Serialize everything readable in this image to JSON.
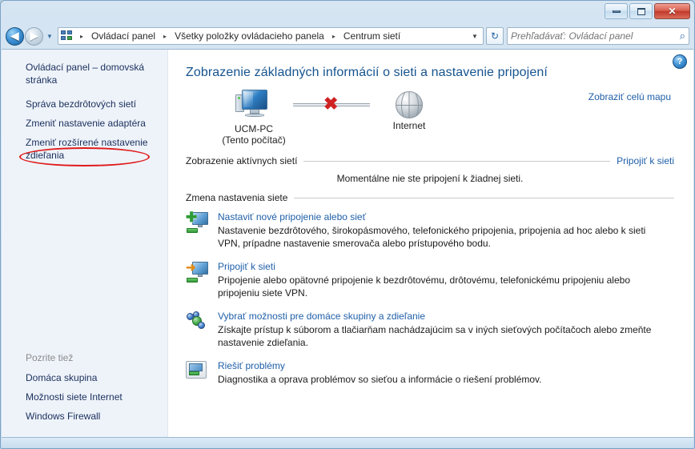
{
  "window": {
    "minimize_label": "—",
    "maximize_label": "❐",
    "close_label": "✕"
  },
  "navigation": {
    "back_label": "◀",
    "forward_label": "▶",
    "history_dropdown_label": "▼",
    "refresh_label": "↻",
    "breadcrumb": [
      "Ovládací panel",
      "Všetky položky ovládacieho panela",
      "Centrum sietí"
    ],
    "breadcrumb_separator": "▸",
    "address_dropdown_label": "▼"
  },
  "search": {
    "placeholder": "Prehľadávať: Ovládací panel",
    "value": "",
    "icon_label": "⌕"
  },
  "sidebar": {
    "home_link": "Ovládací panel – domovská stránka",
    "items": [
      "Správa bezdrôtových sietí",
      "Zmeniť nastavenie adaptéra",
      "Zmeniť rozšírené nastavenie zdieľania"
    ],
    "see_also_heading": "Pozrite tiež",
    "see_also": [
      "Domáca skupina",
      "Možnosti siete Internet",
      "Windows Firewall"
    ],
    "highlight_color": "#e01b1b"
  },
  "content": {
    "help_label": "?",
    "title": "Zobrazenie základných informácií o sieti a nastavenie pripojení",
    "map": {
      "view_full_map": "Zobraziť celú mapu",
      "computer_name": "UCM-PC",
      "computer_sub": "(Tento počítač)",
      "internet_label": "Internet",
      "connection_broken_mark": "✖"
    },
    "active_networks": {
      "title": "Zobrazenie aktívnych sietí",
      "action": "Pripojiť k sieti",
      "status": "Momentálne nie ste pripojení k žiadnej sieti."
    },
    "change_settings": {
      "title": "Zmena nastavenia siete"
    },
    "tasks": [
      {
        "icon": "setup-new-connection-icon",
        "link": "Nastaviť nové pripojenie alebo sieť",
        "description": "Nastavenie bezdrôtového, širokopásmového, telefonického pripojenia, pripojenia ad hoc alebo k sieti VPN, prípadne nastavenie smerovača alebo prístupového bodu."
      },
      {
        "icon": "connect-to-network-icon",
        "link": "Pripojiť k sieti",
        "description": "Pripojenie alebo opätovné pripojenie k bezdrôtovému, drôtovému, telefonickému pripojeniu alebo pripojeniu siete VPN."
      },
      {
        "icon": "homegroup-sharing-icon",
        "link": "Vybrať možnosti pre domáce skupiny a zdieľanie",
        "description": "Získajte prístup k súborom a tlačiarňam nachádzajúcim sa v iných sieťových počítačoch alebo zmeňte nastavenie zdieľania."
      },
      {
        "icon": "troubleshoot-icon",
        "link": "Riešiť problémy",
        "description": "Diagnostika a oprava problémov so sieťou a informácie o riešení problémov."
      }
    ]
  },
  "colors": {
    "link": "#1f5fa8",
    "title": "#16548f",
    "sidebar_bg": "#eef3fa",
    "close_button": "#bf3a2c"
  }
}
